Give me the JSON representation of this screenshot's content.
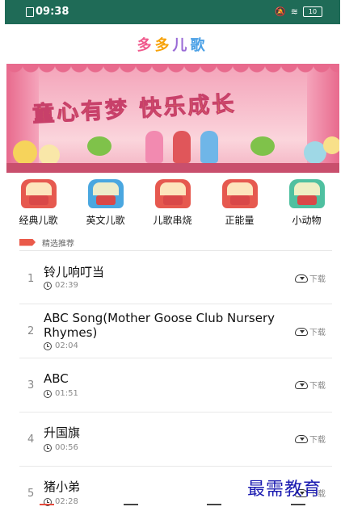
{
  "status_bar": {
    "time": "09:38",
    "battery": "10"
  },
  "header": {
    "title_chars": [
      "多",
      "多",
      "儿",
      "歌"
    ]
  },
  "banner": {
    "slogan": "童心有梦 快乐成长"
  },
  "categories": [
    {
      "label": "经典儿歌",
      "color": "#e6594f"
    },
    {
      "label": "英文儿歌",
      "color": "#4aa7e0"
    },
    {
      "label": "儿歌串烧",
      "color": "#e6594f"
    },
    {
      "label": "正能量",
      "color": "#e6594f"
    },
    {
      "label": "小动物",
      "color": "#4fc0a0"
    }
  ],
  "section": {
    "title": "精选推荐"
  },
  "songs": [
    {
      "index": "1",
      "title": "铃儿响叮当",
      "duration": "02:39",
      "download": "下载"
    },
    {
      "index": "2",
      "title": "ABC Song(Mother Goose Club Nursery Rhymes)",
      "duration": "02:04",
      "download": "下载"
    },
    {
      "index": "3",
      "title": "ABC",
      "duration": "01:51",
      "download": "下载"
    },
    {
      "index": "4",
      "title": "升国旗",
      "duration": "00:56",
      "download": "下载"
    },
    {
      "index": "5",
      "title": "猪小弟",
      "duration": "02:28",
      "download": "下载"
    }
  ],
  "watermark": "最需教育",
  "colors": {
    "status_bar": "#1f6b57",
    "accent": "#ea5a4a"
  }
}
